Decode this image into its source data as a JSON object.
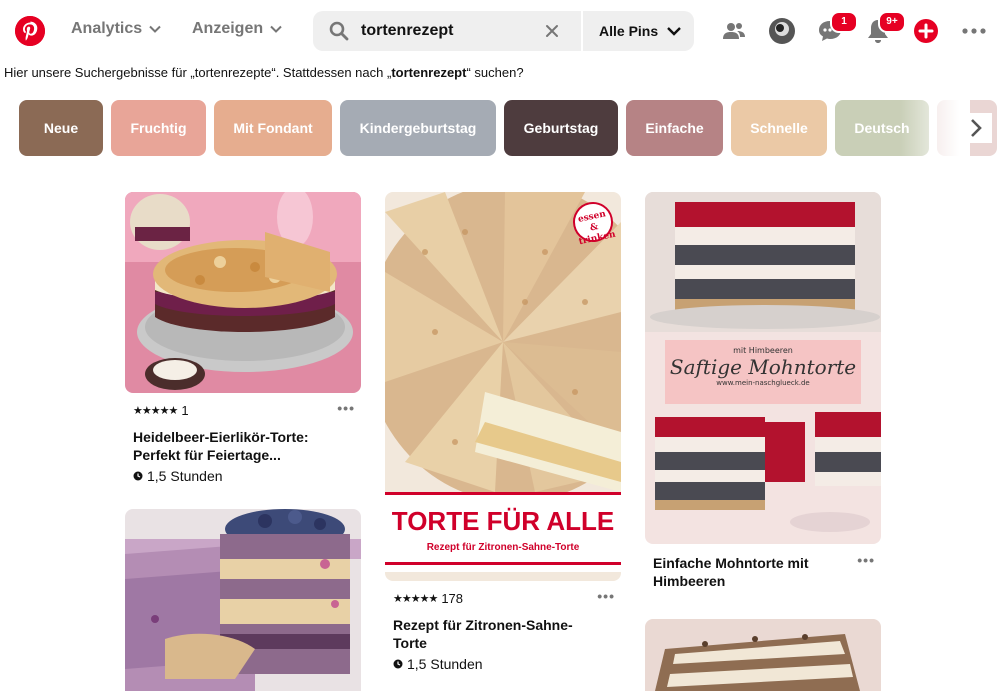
{
  "header": {
    "nav": [
      {
        "label": "Analytics"
      },
      {
        "label": "Anzeigen"
      }
    ],
    "search": {
      "query": "tortenrezept",
      "scope": "Alle Pins"
    },
    "badges": {
      "messages": "1",
      "notifications": "9+"
    }
  },
  "notice": {
    "prefix": "Hier unsere Suchergebnisse für „tortenrezepte“. Stattdessen nach „",
    "term": "tortenrezept",
    "suffix": "“ suchen?"
  },
  "chips": [
    {
      "label": "Neue",
      "color": "#8b6a55"
    },
    {
      "label": "Fruchtig",
      "color": "#e8a598"
    },
    {
      "label": "Mit Fondant",
      "color": "#e6ad8f"
    },
    {
      "label": "Kindergeburtstag",
      "color": "#a5abb4"
    },
    {
      "label": "Geburtstag",
      "color": "#4e3c3e"
    },
    {
      "label": "Einfache",
      "color": "#b68385"
    },
    {
      "label": "Schnelle",
      "color": "#ebc9a6"
    },
    {
      "label": "Deutsch",
      "color": "#c9cfb7"
    },
    {
      "label": "",
      "color": "#ead6d4"
    }
  ],
  "pins": [
    {
      "stars": "★★★★★",
      "count": "1",
      "title": "Heidelbeer-Eierlikör-Torte: Perfekt für Feiertage...",
      "time": "1,5 Stunden"
    },
    {
      "stars": "★★★★★",
      "count": "178",
      "title": "Rezept für Zitronen-Sahne-Torte",
      "time": "1,5 Stunden",
      "banner_title": "TORTE FÜR ALLE",
      "banner_sub": "Rezept für Zitronen-Sahne-Torte",
      "stamp": "essen & trinken"
    },
    {
      "title": "Einfache Mohntorte mit Himbeeren",
      "overlay_small": "mit Himbeeren",
      "overlay_title": "Saftige Mohntorte",
      "overlay_url": "www.mein-naschglueck.de"
    },
    {},
    {}
  ],
  "colors": {
    "brand": "#e60023",
    "muted": "#767676"
  }
}
